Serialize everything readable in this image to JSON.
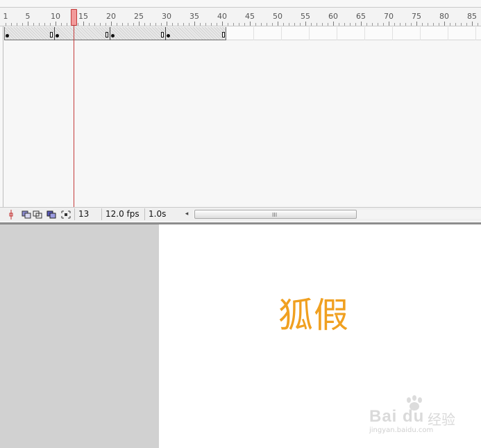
{
  "timeline": {
    "ruler_labels": [
      "1",
      "5",
      "10",
      "15",
      "20",
      "25",
      "30",
      "35",
      "40",
      "45",
      "50",
      "55",
      "60",
      "65",
      "70",
      "75",
      "80",
      "85"
    ],
    "current_frame": "13",
    "frame_rate": "12.0 fps",
    "elapsed_time": "1.0s",
    "scroll_grip": "III",
    "scroll_left_arrow": "◂"
  },
  "stage": {
    "text": "狐假",
    "text_color": "#f0a020"
  },
  "watermark": {
    "logo": "Bai du",
    "logo_cn": "经验",
    "url": "jingyan.baidu.com"
  },
  "icons": {
    "onion_center": "onion-center-icon",
    "onion_skin": "onion-skin-icon",
    "onion_outline": "onion-outline-icon",
    "edit_multiple": "edit-multiple-frames-icon",
    "modify_markers": "modify-markers-icon"
  }
}
